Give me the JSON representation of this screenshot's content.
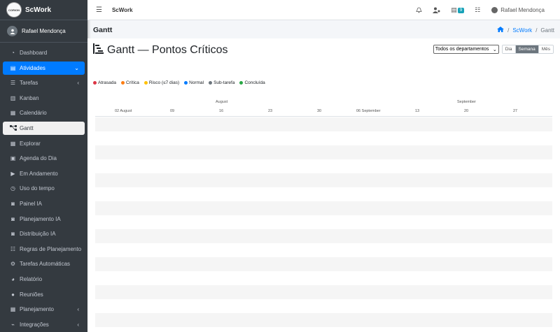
{
  "brand": {
    "logo_text": "CORION",
    "name": "ScWork"
  },
  "user": {
    "name": "Rafael Mendonça"
  },
  "sidebar": {
    "items": [
      {
        "label": "Dashboard",
        "icon": "gauge-icon"
      },
      {
        "label": "Atividades",
        "icon": "clipboard-icon"
      },
      {
        "label": "Tarefas",
        "icon": "tasks-icon"
      },
      {
        "label": "Kanban",
        "icon": "columns-icon"
      },
      {
        "label": "Calendário",
        "icon": "calendar-icon"
      },
      {
        "label": "Gantt",
        "icon": "sitemap-icon"
      },
      {
        "label": "Explorar",
        "icon": "grid-icon"
      },
      {
        "label": "Agenda do Dia",
        "icon": "calendar-day-icon"
      },
      {
        "label": "Em Andamento",
        "icon": "play-circle-icon"
      },
      {
        "label": "Uso do tempo",
        "icon": "clock-icon"
      },
      {
        "label": "Painel IA",
        "icon": "robot-icon"
      },
      {
        "label": "Planejamento IA",
        "icon": "robot-icon"
      },
      {
        "label": "Distribuição IA",
        "icon": "robot-icon"
      },
      {
        "label": "Regras de Planejamento",
        "icon": "rules-icon"
      },
      {
        "label": "Tarefas Automáticas",
        "icon": "cogs-icon"
      },
      {
        "label": "Relatório",
        "icon": "chart-pie-icon"
      },
      {
        "label": "Reuniões",
        "icon": "users-icon"
      },
      {
        "label": "Planejamento",
        "icon": "calendar-icon"
      },
      {
        "label": "Integrações",
        "icon": "plug-icon"
      }
    ]
  },
  "topbar": {
    "title": "ScWork",
    "badge_count": "9",
    "user_name": "Rafael Mendonça"
  },
  "page": {
    "title": "Gantt"
  },
  "breadcrumb": {
    "link": "ScWork",
    "current": "Gantt"
  },
  "gantt": {
    "title": "Gantt — Pontos Críticos",
    "department_select": "Todos os departamentos",
    "view_modes": [
      "Dia",
      "Semana",
      "Mês"
    ],
    "active_view": "Semana",
    "legend": [
      {
        "label": "Atrasada",
        "color": "#dc3545"
      },
      {
        "label": "Crítica",
        "color": "#fd7e14"
      },
      {
        "label": "Risco (≤7 dias)",
        "color": "#ffc107"
      },
      {
        "label": "Normal",
        "color": "#007bff"
      },
      {
        "label": "Sub-tarefa",
        "color": "#6c757d"
      },
      {
        "label": "Concluída",
        "color": "#28a745"
      }
    ],
    "months": [
      "August",
      "September"
    ],
    "ticks": [
      "02 August",
      "09",
      "16",
      "23",
      "30",
      "06 September",
      "13",
      "20",
      "27"
    ]
  }
}
